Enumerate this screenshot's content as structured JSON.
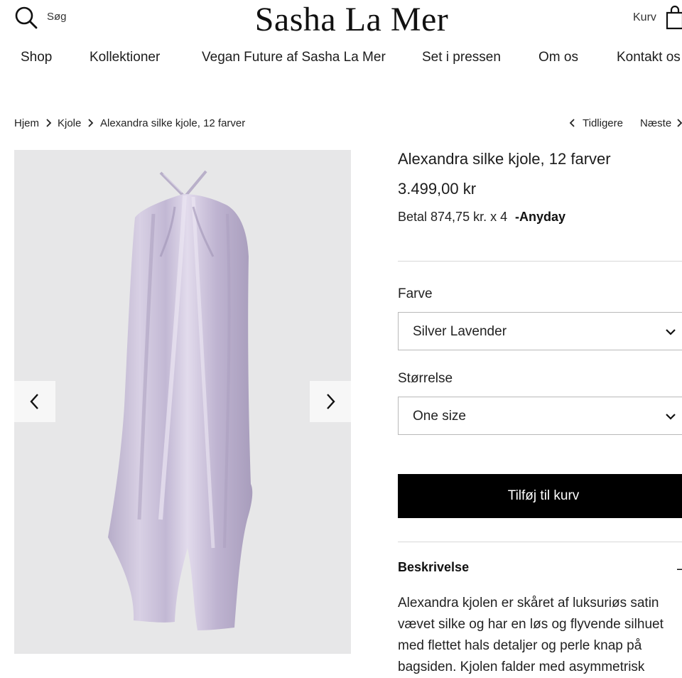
{
  "header": {
    "search_label": "Søg",
    "logo": "Sasha La Mer",
    "cart_label": "Kurv"
  },
  "nav": {
    "items": [
      {
        "label": "Shop"
      },
      {
        "label": "Kollektioner"
      },
      {
        "label": "Vegan Future af Sasha La Mer"
      },
      {
        "label": "Set i pressen"
      },
      {
        "label": "Om os"
      },
      {
        "label": "Kontakt os"
      }
    ]
  },
  "breadcrumb": {
    "items": [
      "Hjem",
      "Kjole",
      "Alexandra silke kjole, 12 farver"
    ],
    "previous": "Tidligere",
    "next": "Næste"
  },
  "product": {
    "title": "Alexandra silke kjole, 12 farver",
    "price": "3.499,00 kr",
    "installment_text": "Betal 874,75 kr. x 4",
    "installment_provider": "-Anyday",
    "color_label": "Farve",
    "color_value": "Silver Lavender",
    "size_label": "Størrelse",
    "size_value": "One size",
    "add_to_cart": "Tilføj til kurv",
    "description_heading": "Beskrivelse",
    "description_toggle": "–",
    "description_text": "Alexandra kjolen er skåret af luksuriøs satin vævet silke og har en løs og flyvende silhuet med flettet hals detaljer og perle knap på bagsiden. Kjolen falder med asymmetrisk"
  },
  "colors": {
    "accent": "#000000",
    "gallery_bg": "#e7e7e8",
    "dress": "#c9bfd8"
  }
}
